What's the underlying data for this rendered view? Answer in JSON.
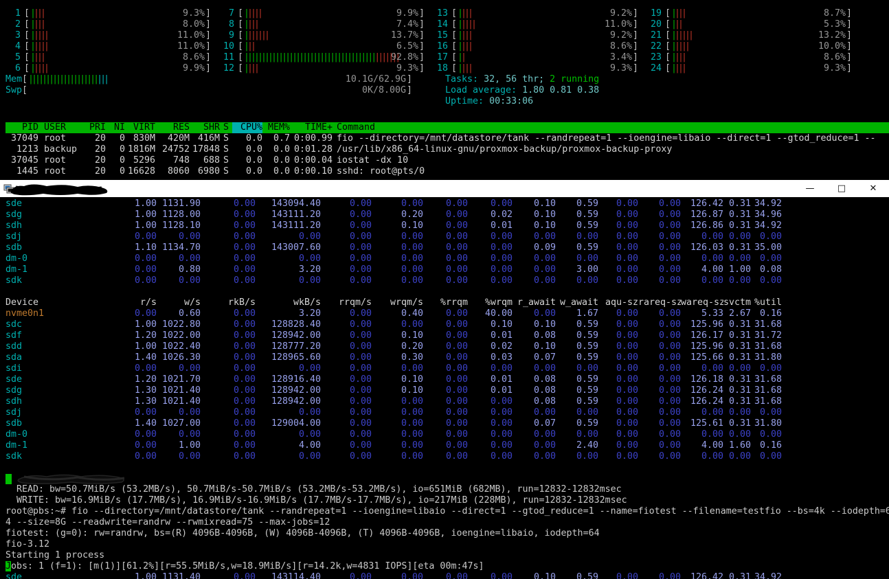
{
  "colors": {
    "text": "#c9c9c9",
    "cyan": "#00b0b0",
    "bar_green": "#00b400",
    "bar_red": "#b93226",
    "pct_gray": "#969696",
    "header_green": "#00b200",
    "sort_cyan": "#00b0b0",
    "dev_cyan": "#00b0b0",
    "nvme_orange": "#bf7a2e",
    "val_blue": "#98a1ec",
    "zero_blue": "#3c42c8",
    "running_green": "#00c000",
    "cursor_green": "#00c000"
  },
  "htop": {
    "cpus": [
      {
        "id": "1",
        "pct": "9.3%",
        "load": 9.3
      },
      {
        "id": "2",
        "pct": "8.0%",
        "load": 8.0
      },
      {
        "id": "3",
        "pct": "11.0%",
        "load": 11.0
      },
      {
        "id": "4",
        "pct": "11.0%",
        "load": 11.0
      },
      {
        "id": "5",
        "pct": "8.6%",
        "load": 8.6
      },
      {
        "id": "6",
        "pct": "9.9%",
        "load": 9.9
      },
      {
        "id": "7",
        "pct": "9.9%",
        "load": 9.9
      },
      {
        "id": "8",
        "pct": "7.4%",
        "load": 7.4
      },
      {
        "id": "9",
        "pct": "13.7%",
        "load": 13.7
      },
      {
        "id": "10",
        "pct": "6.5%",
        "load": 6.5
      },
      {
        "id": "11",
        "pct": "92.8%",
        "load": 92.8
      },
      {
        "id": "12",
        "pct": "9.3%",
        "load": 9.3
      },
      {
        "id": "13",
        "pct": "9.2%",
        "load": 9.2
      },
      {
        "id": "14",
        "pct": "11.0%",
        "load": 11.0
      },
      {
        "id": "15",
        "pct": "9.2%",
        "load": 9.2
      },
      {
        "id": "16",
        "pct": "8.6%",
        "load": 8.6
      },
      {
        "id": "17",
        "pct": "3.4%",
        "load": 3.4
      },
      {
        "id": "18",
        "pct": "9.3%",
        "load": 9.3
      },
      {
        "id": "19",
        "pct": "8.7%",
        "load": 8.7
      },
      {
        "id": "20",
        "pct": "5.3%",
        "load": 5.3
      },
      {
        "id": "21",
        "pct": "13.2%",
        "load": 13.2
      },
      {
        "id": "22",
        "pct": "10.0%",
        "load": 10.0
      },
      {
        "id": "23",
        "pct": "8.6%",
        "load": 8.6
      },
      {
        "id": "24",
        "pct": "9.3%",
        "load": 9.3
      }
    ],
    "mem": {
      "label": "Mem",
      "value": "10.1G/62.9G",
      "green_bars": 20,
      "cyan_bars": 3
    },
    "swp": {
      "label": "Swp",
      "value": "0K/8.00G"
    },
    "tasks": {
      "label": "Tasks:",
      "value": "32, 56 thr;",
      "running": "2 running"
    },
    "load": {
      "label": "Load average:",
      "value": "1.80 0.81 0.38"
    },
    "uptime": {
      "label": "Uptime:",
      "value": "00:33:06"
    },
    "process_table": {
      "headers": [
        "PID",
        "USER",
        "PRI",
        "NI",
        "VIRT",
        "RES",
        "SHR",
        "S",
        "CPU%",
        "MEM%",
        "TIME+",
        "Command"
      ],
      "sort_column": "CPU%",
      "rows": [
        [
          "37049",
          "root",
          "20",
          "0",
          "830M",
          "420M",
          "416M",
          "S",
          "0.0",
          "0.7",
          "0:00.99",
          "fio --directory=/mnt/datastore/tank --randrepeat=1 --ioengine=libaio --direct=1 --gtod_reduce=1 --"
        ],
        [
          "1213",
          "backup",
          "20",
          "0",
          "1816M",
          "24752",
          "17848",
          "S",
          "0.0",
          "0.0",
          "0:01.28",
          "/usr/lib/x86_64-linux-gnu/proxmox-backup/proxmox-backup-proxy"
        ],
        [
          "37045",
          "root",
          "20",
          "0",
          "5296",
          "748",
          "688",
          "S",
          "0.0",
          "0.0",
          "0:00.04",
          "iostat -dx 10"
        ],
        [
          "1445",
          "root",
          "20",
          "0",
          "16628",
          "8060",
          "6980",
          "S",
          "0.0",
          "0.0",
          "0:00.10",
          "sshd: root@pts/0"
        ]
      ]
    }
  },
  "window": {
    "controls": {
      "minimize": "—",
      "maximize": "□",
      "close": "✕"
    }
  },
  "iostat": {
    "columns": [
      "Device",
      "r/s",
      "w/s",
      "rkB/s",
      "wkB/s",
      "rrqm/s",
      "wrqm/s",
      "%rrqm",
      "%wrqm",
      "r_await",
      "w_await",
      "aqu-sz",
      "rareq-sz",
      "wareq-sz",
      "svctm",
      "%util"
    ],
    "block1": [
      {
        "device": "sde",
        "values": [
          "1.00",
          "1131.90",
          "0.00",
          "143094.40",
          "0.00",
          "0.00",
          "0.00",
          "0.00",
          "0.10",
          "0.59",
          "0.00",
          "0.00",
          "126.42",
          "0.31",
          "34.92"
        ]
      },
      {
        "device": "sdg",
        "values": [
          "1.00",
          "1128.00",
          "0.00",
          "143111.20",
          "0.00",
          "0.20",
          "0.00",
          "0.02",
          "0.10",
          "0.59",
          "0.00",
          "0.00",
          "126.87",
          "0.31",
          "34.96"
        ]
      },
      {
        "device": "sdh",
        "values": [
          "1.00",
          "1128.10",
          "0.00",
          "143111.20",
          "0.00",
          "0.10",
          "0.00",
          "0.01",
          "0.10",
          "0.59",
          "0.00",
          "0.00",
          "126.86",
          "0.31",
          "34.92"
        ]
      },
      {
        "device": "sdj",
        "values": [
          "0.00",
          "0.00",
          "0.00",
          "0.00",
          "0.00",
          "0.00",
          "0.00",
          "0.00",
          "0.00",
          "0.00",
          "0.00",
          "0.00",
          "0.00",
          "0.00",
          "0.00"
        ]
      },
      {
        "device": "sdb",
        "values": [
          "1.10",
          "1134.70",
          "0.00",
          "143007.60",
          "0.00",
          "0.00",
          "0.00",
          "0.00",
          "0.09",
          "0.59",
          "0.00",
          "0.00",
          "126.03",
          "0.31",
          "35.00"
        ]
      },
      {
        "device": "dm-0",
        "values": [
          "0.00",
          "0.00",
          "0.00",
          "0.00",
          "0.00",
          "0.00",
          "0.00",
          "0.00",
          "0.00",
          "0.00",
          "0.00",
          "0.00",
          "0.00",
          "0.00",
          "0.00"
        ]
      },
      {
        "device": "dm-1",
        "values": [
          "0.00",
          "0.80",
          "0.00",
          "3.20",
          "0.00",
          "0.00",
          "0.00",
          "0.00",
          "0.00",
          "3.00",
          "0.00",
          "0.00",
          "4.00",
          "1.00",
          "0.08"
        ]
      },
      {
        "device": "sdk",
        "values": [
          "0.00",
          "0.00",
          "0.00",
          "0.00",
          "0.00",
          "0.00",
          "0.00",
          "0.00",
          "0.00",
          "0.00",
          "0.00",
          "0.00",
          "0.00",
          "0.00",
          "0.00"
        ]
      }
    ],
    "block2": [
      {
        "device": "nvme0n1",
        "values": [
          "0.00",
          "0.60",
          "0.00",
          "3.20",
          "0.00",
          "0.40",
          "0.00",
          "40.00",
          "0.00",
          "1.67",
          "0.00",
          "0.00",
          "5.33",
          "2.67",
          "0.16"
        ]
      },
      {
        "device": "sdc",
        "values": [
          "1.00",
          "1022.80",
          "0.00",
          "128828.40",
          "0.00",
          "0.00",
          "0.00",
          "0.10",
          "0.10",
          "0.59",
          "0.00",
          "0.00",
          "125.96",
          "0.31",
          "31.68"
        ]
      },
      {
        "device": "sdf",
        "values": [
          "1.20",
          "1022.00",
          "0.00",
          "128942.00",
          "0.00",
          "0.10",
          "0.00",
          "0.01",
          "0.08",
          "0.59",
          "0.00",
          "0.00",
          "126.17",
          "0.31",
          "31.72"
        ]
      },
      {
        "device": "sdd",
        "values": [
          "1.00",
          "1022.40",
          "0.00",
          "128777.20",
          "0.00",
          "0.20",
          "0.00",
          "0.02",
          "0.10",
          "0.59",
          "0.00",
          "0.00",
          "125.96",
          "0.31",
          "31.68"
        ]
      },
      {
        "device": "sda",
        "values": [
          "1.40",
          "1026.30",
          "0.00",
          "128965.60",
          "0.00",
          "0.30",
          "0.00",
          "0.03",
          "0.07",
          "0.59",
          "0.00",
          "0.00",
          "125.66",
          "0.31",
          "31.80"
        ]
      },
      {
        "device": "sdi",
        "values": [
          "0.00",
          "0.00",
          "0.00",
          "0.00",
          "0.00",
          "0.00",
          "0.00",
          "0.00",
          "0.00",
          "0.00",
          "0.00",
          "0.00",
          "0.00",
          "0.00",
          "0.00"
        ]
      },
      {
        "device": "sde",
        "values": [
          "1.20",
          "1021.70",
          "0.00",
          "128916.40",
          "0.00",
          "0.10",
          "0.00",
          "0.01",
          "0.08",
          "0.59",
          "0.00",
          "0.00",
          "126.18",
          "0.31",
          "31.68"
        ]
      },
      {
        "device": "sdg",
        "values": [
          "1.30",
          "1021.40",
          "0.00",
          "128942.00",
          "0.00",
          "0.10",
          "0.00",
          "0.01",
          "0.08",
          "0.59",
          "0.00",
          "0.00",
          "126.24",
          "0.31",
          "31.68"
        ]
      },
      {
        "device": "sdh",
        "values": [
          "1.30",
          "1021.40",
          "0.00",
          "128942.00",
          "0.00",
          "0.00",
          "0.00",
          "0.00",
          "0.08",
          "0.59",
          "0.00",
          "0.00",
          "126.24",
          "0.31",
          "31.68"
        ]
      },
      {
        "device": "sdj",
        "values": [
          "0.00",
          "0.00",
          "0.00",
          "0.00",
          "0.00",
          "0.00",
          "0.00",
          "0.00",
          "0.00",
          "0.00",
          "0.00",
          "0.00",
          "0.00",
          "0.00",
          "0.00"
        ]
      },
      {
        "device": "sdb",
        "values": [
          "1.40",
          "1027.00",
          "0.00",
          "129004.00",
          "0.00",
          "0.00",
          "0.00",
          "0.00",
          "0.07",
          "0.59",
          "0.00",
          "0.00",
          "125.61",
          "0.31",
          "31.80"
        ]
      },
      {
        "device": "dm-0",
        "values": [
          "0.00",
          "0.00",
          "0.00",
          "0.00",
          "0.00",
          "0.00",
          "0.00",
          "0.00",
          "0.00",
          "0.00",
          "0.00",
          "0.00",
          "0.00",
          "0.00",
          "0.00"
        ]
      },
      {
        "device": "dm-1",
        "values": [
          "0.00",
          "1.00",
          "0.00",
          "4.00",
          "0.00",
          "0.00",
          "0.00",
          "0.00",
          "0.00",
          "2.40",
          "0.00",
          "0.00",
          "4.00",
          "1.60",
          "0.16"
        ]
      },
      {
        "device": "sdk",
        "values": [
          "0.00",
          "0.00",
          "0.00",
          "0.00",
          "0.00",
          "0.00",
          "0.00",
          "0.00",
          "0.00",
          "0.00",
          "0.00",
          "0.00",
          "0.00",
          "0.00",
          "0.00"
        ]
      }
    ],
    "partial_row": {
      "device": "sde",
      "values": [
        "1.00",
        "1131.40",
        "0.00",
        "143114.40",
        "0.00",
        "0.00",
        "0.00",
        "0.00",
        "0.10",
        "0.59",
        "0.00",
        "0.00",
        "126.42",
        "0.31",
        "34.92"
      ]
    }
  },
  "fio": {
    "read_line": "  READ: bw=50.7MiB/s (53.2MB/s), 50.7MiB/s-50.7MiB/s (53.2MB/s-53.2MB/s), io=651MiB (682MB), run=12832-12832msec",
    "write_line": "  WRITE: bw=16.9MiB/s (17.7MB/s), 16.9MiB/s-16.9MiB/s (17.7MB/s-17.7MB/s), io=217MiB (228MB), run=12832-12832msec",
    "prompt_line": "root@pbs:~# fio --directory=/mnt/datastore/tank --randrepeat=1 --ioengine=libaio --direct=1 --gtod_reduce=1 --name=fiotest --filename=testfio --bs=4k --iodepth=6",
    "prompt_wrap_line": "4 --size=8G --readwrite=randrw --rwmixread=75 --max-jobs=12",
    "fiotest_line": "fiotest: (g=0): rw=randrw, bs=(R) 4096B-4096B, (W) 4096B-4096B, (T) 4096B-4096B, ioengine=libaio, iodepth=64",
    "version_line": "fio-3.12",
    "starting_line": "Starting 1 process",
    "jobs_line": "Jobs: 1 (f=1): [m(1)][61.2%][r=55.5MiB/s,w=18.9MiB/s][r=14.2k,w=4831 IOPS][eta 00m:47s]"
  }
}
